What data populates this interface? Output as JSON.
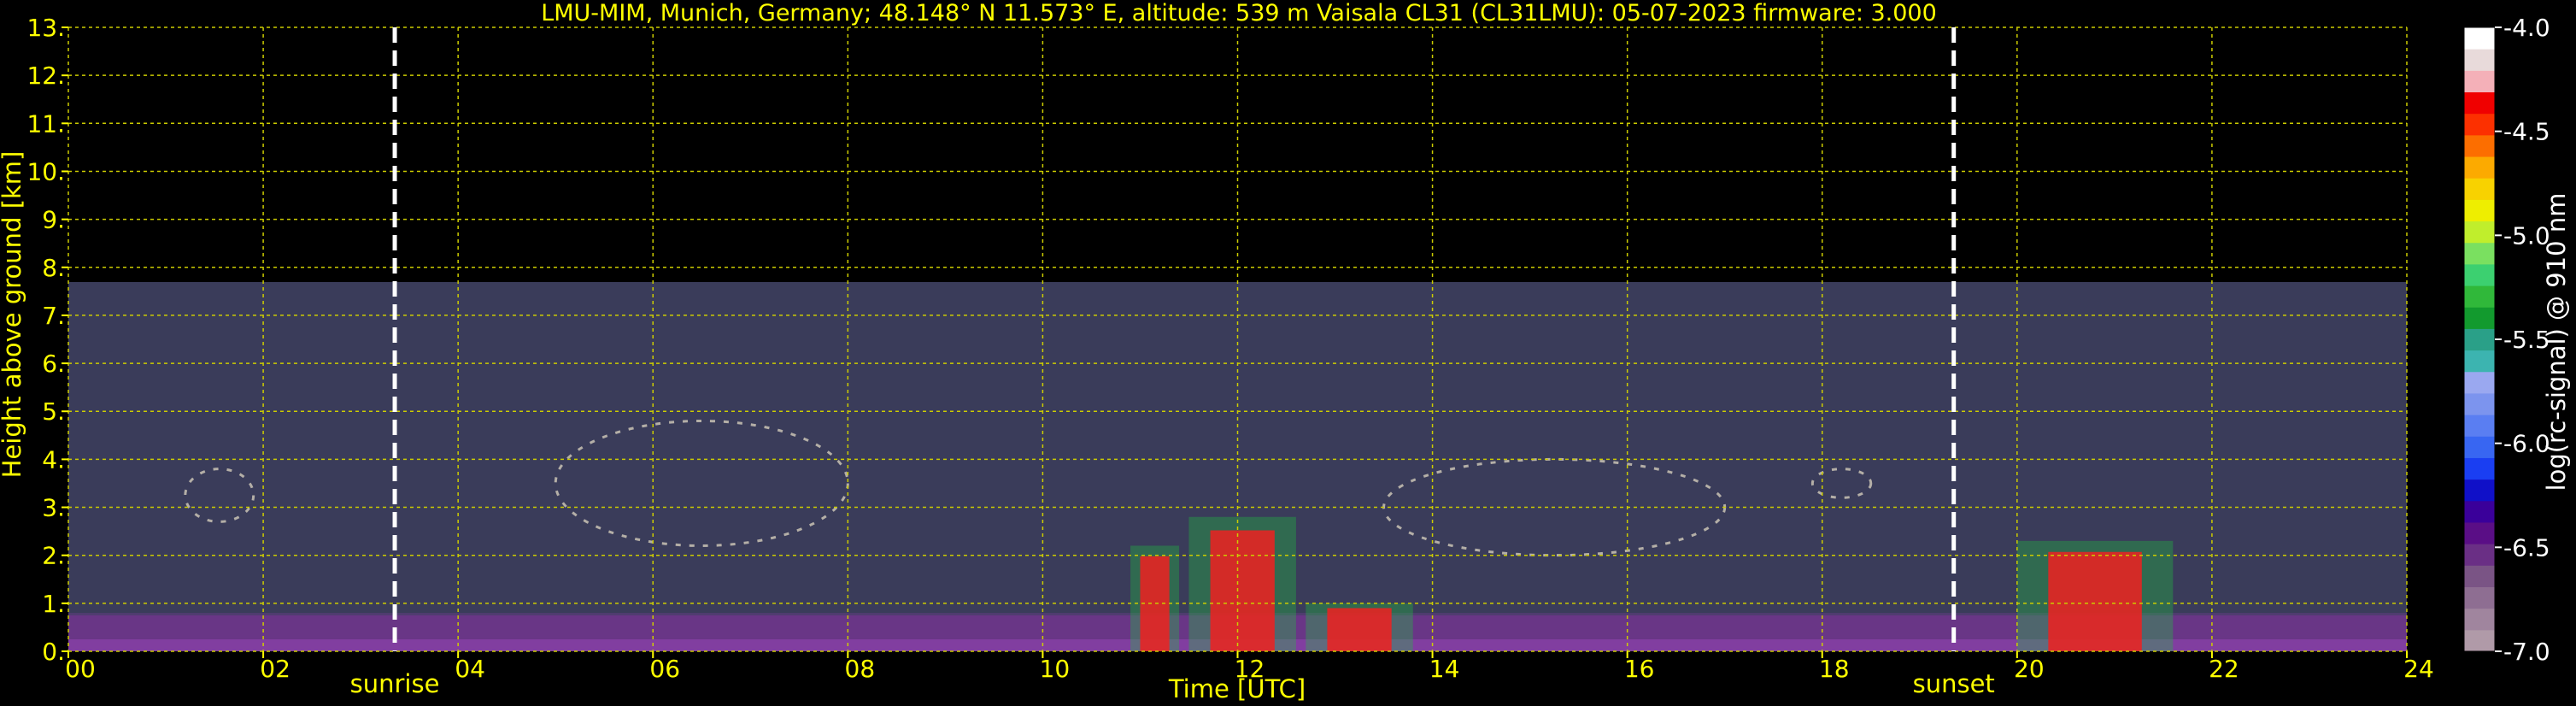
{
  "chart_data": {
    "type": "heatmap",
    "title": "LMU-MIM, Munich, Germany; 48.148° N 11.573° E, altitude: 539 m    Vaisala CL31 (CL31LMU): 05-07-2023    firmware: 3.000",
    "xlabel": "Time [UTC]",
    "ylabel": "Height above ground [km]",
    "xlim": [
      0,
      24
    ],
    "ylim": [
      0,
      13
    ],
    "xticks": [
      0,
      2,
      4,
      6,
      8,
      10,
      12,
      14,
      16,
      18,
      20,
      22,
      24
    ],
    "xtick_labels": [
      "00",
      "02",
      "04",
      "06",
      "08",
      "10",
      "12",
      "14",
      "16",
      "18",
      "20",
      "22",
      "24"
    ],
    "yticks": [
      0,
      1,
      2,
      3,
      4,
      5,
      6,
      7,
      8,
      9,
      10,
      11,
      12,
      13
    ],
    "ytick_labels": [
      "0.",
      "1.",
      "2.",
      "3.",
      "4.",
      "5.",
      "6.",
      "7.",
      "8.",
      "9.",
      "10.",
      "11.",
      "12.",
      "13."
    ],
    "grid": true,
    "grid_color": "#cccc00",
    "data_top_km": 7.7,
    "markers": [
      {
        "label": "sunrise",
        "time": 3.35
      },
      {
        "label": "sunset",
        "time": 19.35
      }
    ],
    "colorbar": {
      "label": "log(rc-signal) @ 910 nm",
      "range": [
        -7.0,
        -4.0
      ],
      "ticks": [
        -7.0,
        -6.5,
        -6.0,
        -5.5,
        -5.0,
        -4.5,
        -4.0
      ],
      "tick_labels": [
        "-7.0",
        "-6.5",
        "-6.0",
        "-5.5",
        "-5.0",
        "-4.5",
        "-4.0"
      ],
      "colors": [
        "#b09aa8",
        "#a0859e",
        "#8e6e92",
        "#7a5485",
        "#6a2f85",
        "#5a0e86",
        "#3a009a",
        "#1010c8",
        "#1a3ef2",
        "#3866f2",
        "#5a7ef2",
        "#7c94ee",
        "#9aa8f0",
        "#3cb4b0",
        "#2aa088",
        "#129a2e",
        "#30b83a",
        "#3cd070",
        "#7ae060",
        "#c0ee2c",
        "#eeee00",
        "#f8d200",
        "#fcaa00",
        "#fc6e00",
        "#fc3000",
        "#f00000",
        "#f4b0b8",
        "#e8dada",
        "#ffffff"
      ]
    },
    "signal_features": [
      {
        "kind": "boundary_layer",
        "t_start": 0,
        "t_end": 24,
        "z_top": 0.8
      },
      {
        "kind": "aerosol_layer",
        "t_start": 1.2,
        "t_end": 1.9,
        "z_start": 2.7,
        "z_end": 3.8
      },
      {
        "kind": "aerosol_layer",
        "t_start": 5.0,
        "t_end": 8.0,
        "z_start": 2.2,
        "z_end": 4.8
      },
      {
        "kind": "cloud",
        "t_start": 10.9,
        "t_end": 11.4,
        "z_start": 0.0,
        "z_end": 2.2
      },
      {
        "kind": "cloud",
        "t_start": 11.5,
        "t_end": 12.6,
        "z_start": 0.0,
        "z_end": 2.8
      },
      {
        "kind": "cloud",
        "t_start": 12.7,
        "t_end": 13.8,
        "z_start": 0.0,
        "z_end": 1.0
      },
      {
        "kind": "aerosol_layer",
        "t_start": 13.5,
        "t_end": 17.0,
        "z_start": 2.0,
        "z_end": 4.0
      },
      {
        "kind": "aerosol_layer",
        "t_start": 17.9,
        "t_end": 18.5,
        "z_start": 3.2,
        "z_end": 3.8
      },
      {
        "kind": "cloud",
        "t_start": 20.0,
        "t_end": 21.6,
        "z_start": 0.0,
        "z_end": 2.3
      }
    ]
  }
}
